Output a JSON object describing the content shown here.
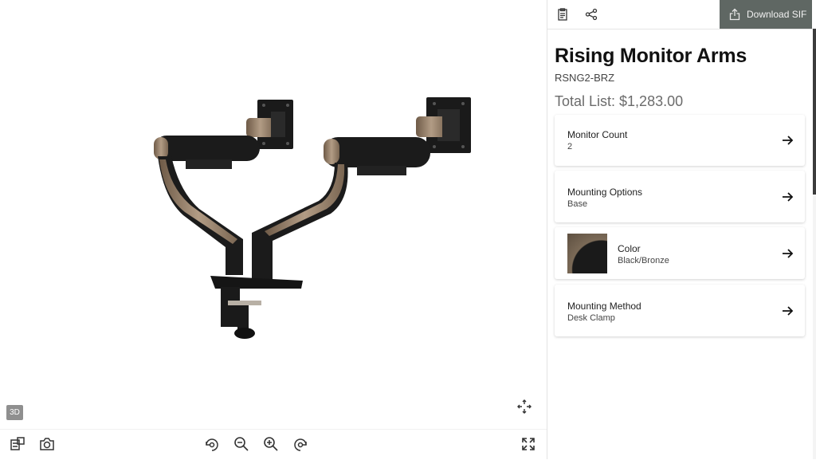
{
  "header": {
    "download_label": "Download SIF",
    "icons": [
      "clipboard-icon",
      "share-icon",
      "upload-icon"
    ]
  },
  "product": {
    "title": "Rising Monitor Arms",
    "sku": "RSNG2-BRZ",
    "total": "Total List: $1,283.00"
  },
  "options": [
    {
      "label": "Monitor Count",
      "value": "2"
    },
    {
      "label": "Mounting Options",
      "value": "Base"
    },
    {
      "label": "Color",
      "value": "Black/Bronze"
    },
    {
      "label": "Mounting Method",
      "value": "Desk Clamp"
    }
  ],
  "viewer": {
    "mode_badge": "3D",
    "toolbar_icons": [
      "ar-view-icon",
      "camera-icon",
      "rotate-left-icon",
      "zoom-out-icon",
      "zoom-in-icon",
      "rotate-right-icon",
      "fullscreen-icon"
    ],
    "recenter_icon": "recenter-icon"
  },
  "colors": {
    "download_bg": "#5f6763",
    "arm_black": "#1b1b1b",
    "bronze": "#8a7560",
    "scroll_thumb": "#3c3c3c"
  }
}
